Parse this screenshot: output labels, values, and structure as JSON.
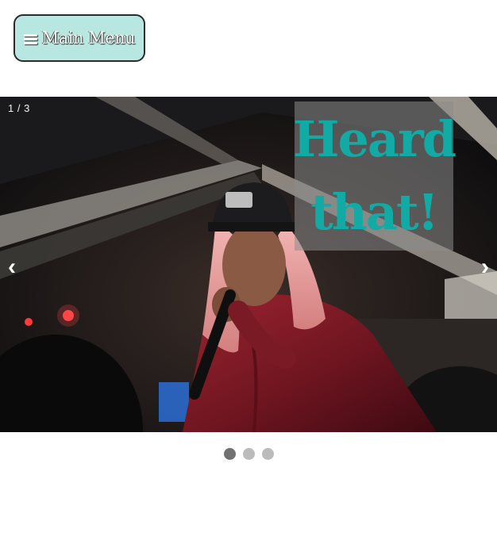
{
  "menu": {
    "icon": "hamburger-icon",
    "label": "Main Menu"
  },
  "slideshow": {
    "counter": "1 / 3",
    "caption": "Heard that!",
    "prev_label": "‹",
    "next_label": "›",
    "current_slide": 1,
    "total_slides": 3,
    "image": "photo of a singer with pink hair and a black cap performing into a microphone at a concert",
    "dots": [
      "slide-1",
      "slide-2",
      "slide-3"
    ]
  },
  "colors": {
    "menu_bg": "#b8e6e0",
    "caption_text": "#12aaa4",
    "active_dot": "#717171",
    "inactive_dot": "#bbbbbb"
  }
}
